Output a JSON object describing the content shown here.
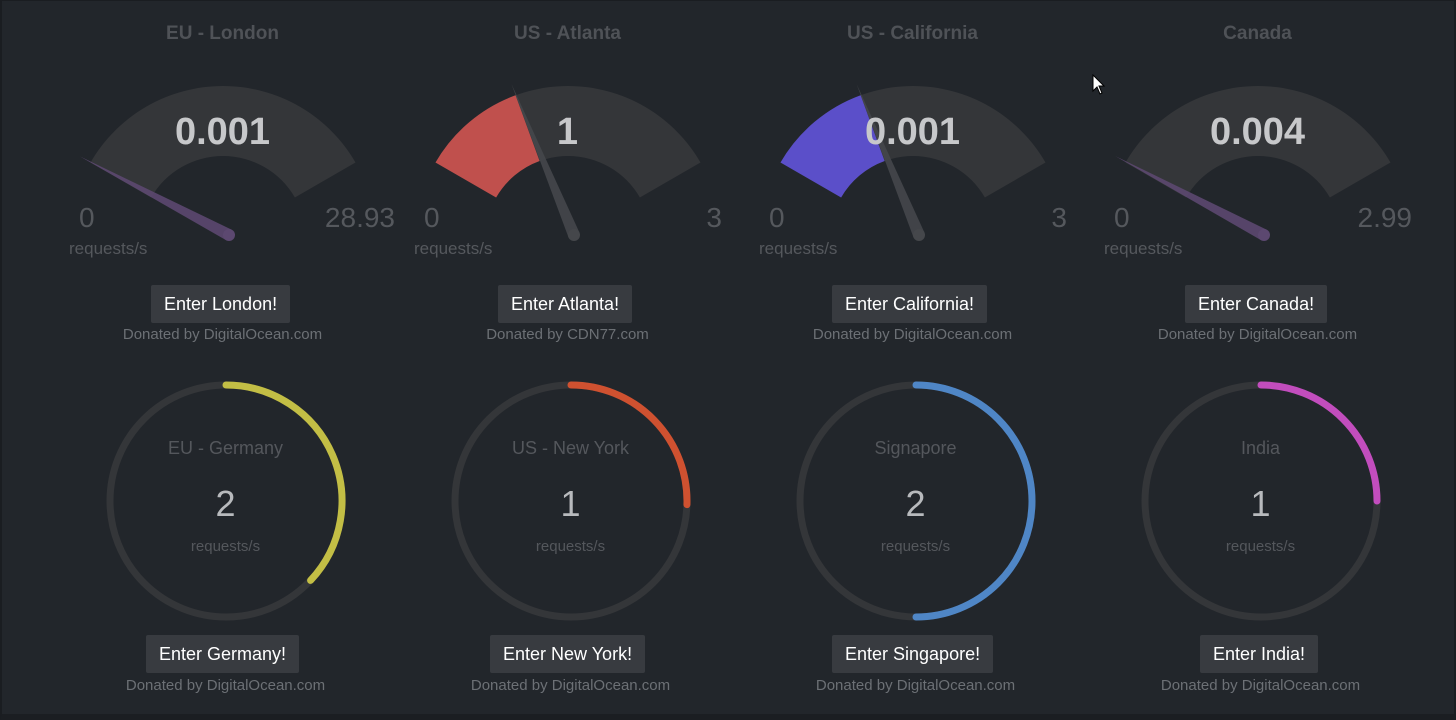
{
  "gauges": [
    {
      "title": "EU - London",
      "value": "0.001",
      "min": "0",
      "max": "28.93",
      "unit": "requests/s",
      "fraction": 3e-05,
      "color": "#5c4870",
      "button": "Enter London!",
      "donated": "Donated by DigitalOcean.com"
    },
    {
      "title": "US - Atlanta",
      "value": "1",
      "min": "0",
      "max": "3",
      "unit": "requests/s",
      "fraction": 0.333,
      "color": "#c0504d",
      "button": "Enter Atlanta!",
      "donated": "Donated by CDN77.com"
    },
    {
      "title": "US - California",
      "value": "0.001",
      "min": "0",
      "max": "3",
      "unit": "requests/s",
      "fraction": 0.3333,
      "color": "#5b4fc9",
      "button": "Enter California!",
      "donated": "Donated by DigitalOcean.com"
    },
    {
      "title": "Canada",
      "value": "0.004",
      "min": "0",
      "max": "2.99",
      "unit": "requests/s",
      "fraction": 0.0013,
      "color": "#5c4870",
      "button": "Enter Canada!",
      "donated": "Donated by DigitalOcean.com"
    }
  ],
  "rings": [
    {
      "label": "EU - Germany",
      "value": "2",
      "unit": "requests/s",
      "fraction": 0.37,
      "color": "#c3be45",
      "button": "Enter Germany!",
      "donated": "Donated by DigitalOcean.com"
    },
    {
      "label": "US - New York",
      "value": "1",
      "unit": "requests/s",
      "fraction": 0.255,
      "color": "#cf5130",
      "button": "Enter New York!",
      "donated": "Donated by DigitalOcean.com"
    },
    {
      "label": "Signapore",
      "value": "2",
      "unit": "requests/s",
      "fraction": 0.5,
      "color": "#4f86c6",
      "button": "Enter Singapore!",
      "donated": "Donated by DigitalOcean.com"
    },
    {
      "label": "India",
      "value": "1",
      "unit": "requests/s",
      "fraction": 0.25,
      "color": "#c24dbd",
      "button": "Enter India!",
      "donated": "Donated by DigitalOcean.com"
    }
  ],
  "colors": {
    "background": "#22262b",
    "track": "#343639",
    "needle": "#45474b"
  }
}
